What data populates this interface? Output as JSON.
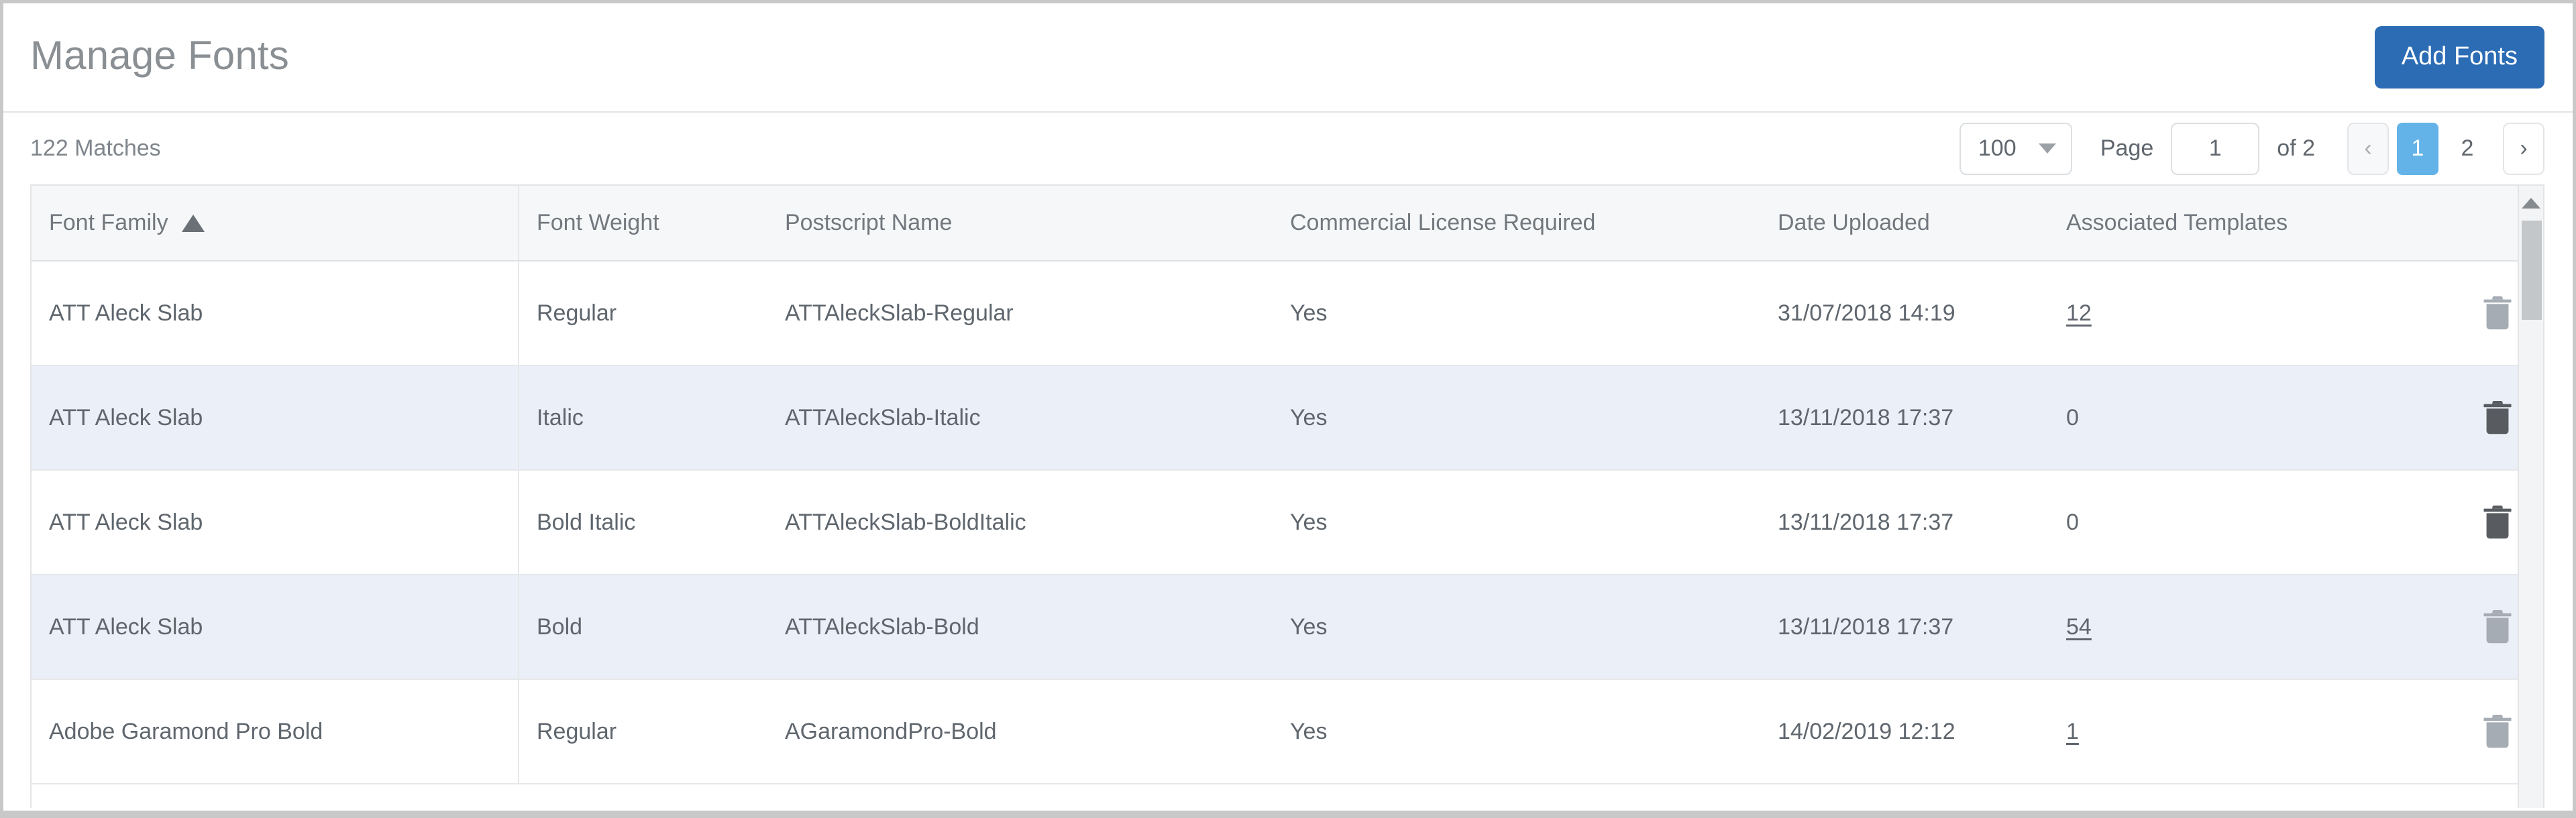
{
  "header": {
    "title": "Manage Fonts",
    "add_fonts_label": "Add Fonts"
  },
  "toolbar": {
    "match_count": "122 Matches",
    "page_size": "100",
    "page_label": "Page",
    "page_value": "1",
    "page_of": "of 2",
    "prev_label": "‹",
    "next_label": "›",
    "pages": [
      "1",
      "2"
    ],
    "active_page": "1"
  },
  "table": {
    "columns": [
      {
        "label": "Font Family",
        "sorted": "asc"
      },
      {
        "label": "Font Weight"
      },
      {
        "label": "Postscript Name"
      },
      {
        "label": "Commercial License Required"
      },
      {
        "label": "Date Uploaded"
      },
      {
        "label": "Associated Templates"
      }
    ],
    "rows": [
      {
        "font_family": "ATT Aleck Slab",
        "font_weight": "Regular",
        "postscript_name": "ATTAleckSlab-Regular",
        "commercial_license_required": "Yes",
        "date_uploaded": "31/07/2018 14:19",
        "associated_templates": "12",
        "templates_is_link": true,
        "delete_enabled": false
      },
      {
        "font_family": "ATT Aleck Slab",
        "font_weight": "Italic",
        "postscript_name": "ATTAleckSlab-Italic",
        "commercial_license_required": "Yes",
        "date_uploaded": "13/11/2018 17:37",
        "associated_templates": "0",
        "templates_is_link": false,
        "delete_enabled": true
      },
      {
        "font_family": "ATT Aleck Slab",
        "font_weight": "Bold Italic",
        "postscript_name": "ATTAleckSlab-BoldItalic",
        "commercial_license_required": "Yes",
        "date_uploaded": "13/11/2018 17:37",
        "associated_templates": "0",
        "templates_is_link": false,
        "delete_enabled": true
      },
      {
        "font_family": "ATT Aleck Slab",
        "font_weight": "Bold",
        "postscript_name": "ATTAleckSlab-Bold",
        "commercial_license_required": "Yes",
        "date_uploaded": "13/11/2018 17:37",
        "associated_templates": "54",
        "templates_is_link": true,
        "delete_enabled": false
      },
      {
        "font_family": "Adobe Garamond Pro Bold",
        "font_weight": "Regular",
        "postscript_name": "AGaramondPro-Bold",
        "commercial_license_required": "Yes",
        "date_uploaded": "14/02/2019 12:12",
        "associated_templates": "1",
        "templates_is_link": true,
        "delete_enabled": false
      }
    ]
  },
  "colors": {
    "accent_button": "#2b6cb5",
    "active_page": "#63b3e8",
    "row_alt": "#ebeff7",
    "header_bg": "#f6f7f8",
    "text": "#5f666d"
  }
}
